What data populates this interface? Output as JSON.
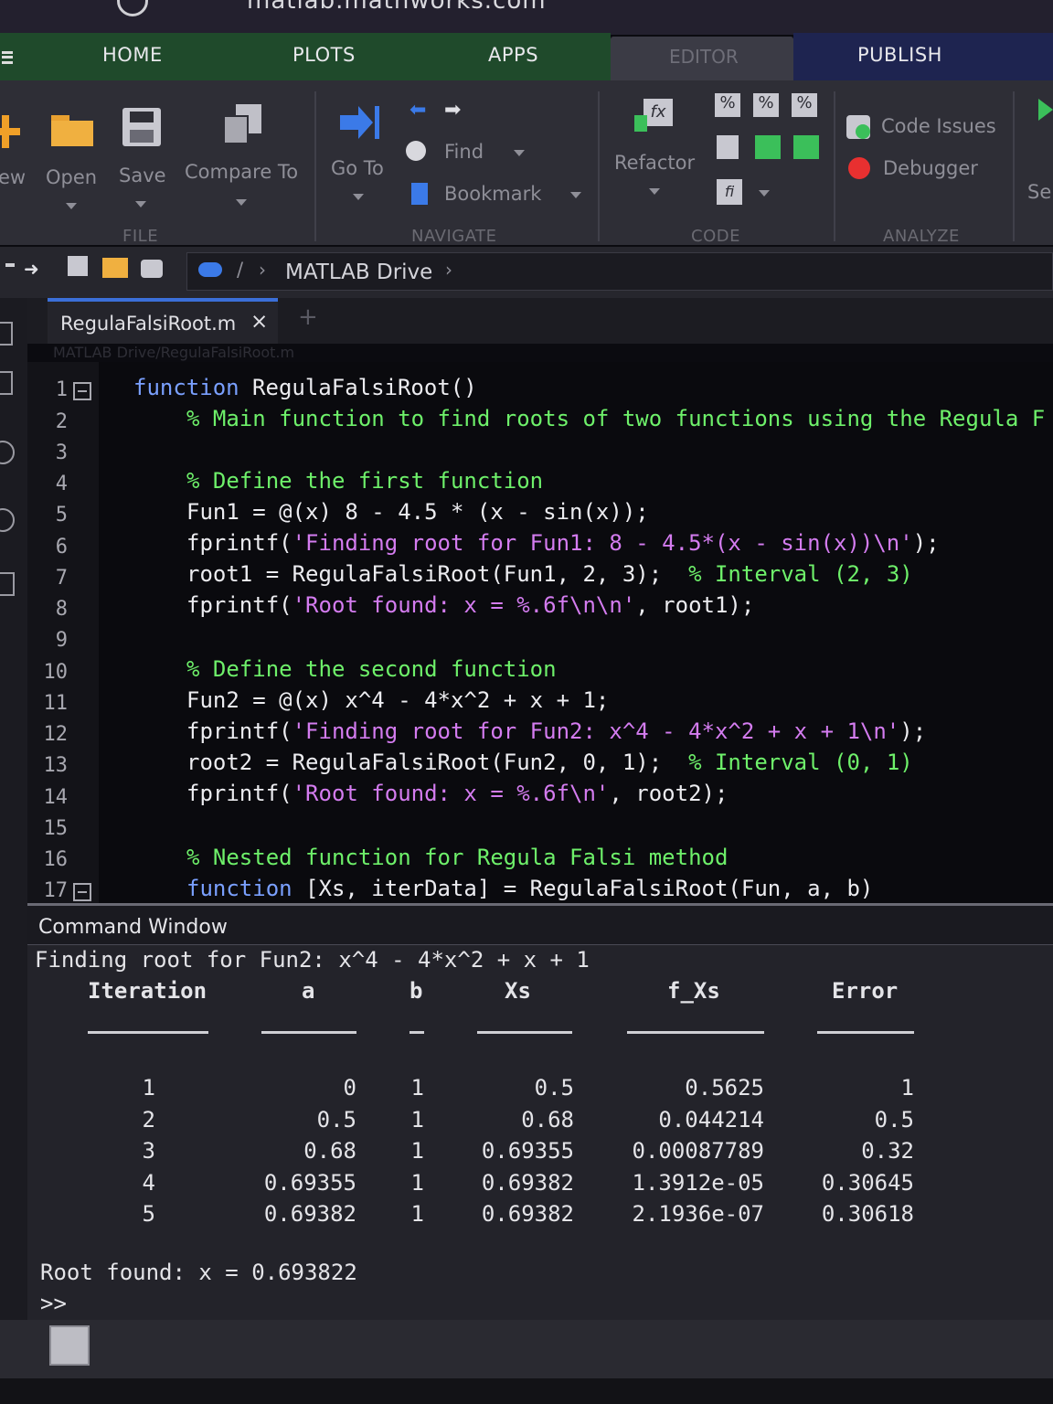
{
  "window": {
    "title": "matlab.mathworks.com"
  },
  "ribbon": {
    "tabs": [
      "HOME",
      "PLOTS",
      "APPS",
      "EDITOR",
      "PUBLISH"
    ],
    "file": {
      "new": "ew",
      "open": "Open",
      "save": "Save",
      "compare": "Compare To",
      "group": "FILE"
    },
    "navigate": {
      "goto": "Go To",
      "find": "Find",
      "bookmark": "Bookmark",
      "group": "NAVIGATE"
    },
    "code": {
      "refactor": "Refactor",
      "group": "CODE"
    },
    "analyze": {
      "code_issues": "Code Issues",
      "debugger": "Debugger",
      "group": "ANALYZE"
    },
    "run": {
      "label": "Se"
    }
  },
  "address": {
    "separator": "/",
    "folder": "MATLAB Drive"
  },
  "editor": {
    "tab_label": "RegulaFalsiRoot.m",
    "close": "×",
    "add": "+",
    "path": "MATLAB Drive/RegulaFalsiRoot.m",
    "line_numbers": [
      "1",
      "2",
      "3",
      "4",
      "5",
      "6",
      "7",
      "8",
      "9",
      "10",
      "11",
      "12",
      "13",
      "14",
      "15",
      "16",
      "17"
    ],
    "lines": {
      "l1_kw": "function",
      "l1_rest": " RegulaFalsiRoot()",
      "l2": "% Main function to find roots of two functions using the Regula F",
      "l4": "% Define the first function",
      "l5": "Fun1 = @(x) 8 - 4.5 * (x - sin(x));",
      "l6_a": "fprintf(",
      "l6_s": "'Finding root for Fun1: 8 - 4.5*(x - sin(x))\\n'",
      "l6_b": ");",
      "l7_a": "root1 = RegulaFalsiRoot(Fun1, 2, 3);  ",
      "l7_c": "% Interval (2, 3)",
      "l8_a": "fprintf(",
      "l8_s": "'Root found: x = %.6f\\n\\n'",
      "l8_b": ", root1);",
      "l10": "% Define the second function",
      "l11": "Fun2 = @(x) x^4 - 4*x^2 + x + 1;",
      "l12_a": "fprintf(",
      "l12_s": "'Finding root for Fun2: x^4 - 4*x^2 + x + 1\\n'",
      "l12_b": ");",
      "l13_a": "root2 = RegulaFalsiRoot(Fun2, 0, 1);  ",
      "l13_c": "% Interval (0, 1)",
      "l14_a": "fprintf(",
      "l14_s": "'Root found: x = %.6f\\n'",
      "l14_b": ", root2);",
      "l16": "% Nested function for Regula Falsi method",
      "l17_kw": "function",
      "l17_rest": " [Xs, iterData] = RegulaFalsiRoot(Fun, a, b)"
    }
  },
  "command_window": {
    "title": "Command Window",
    "intro": "Finding root for Fun2: x^4 - 4*x^2 + x + 1",
    "columns": [
      "Iteration",
      "a",
      "b",
      "Xs",
      "f_Xs",
      "Error"
    ],
    "rows": [
      [
        "1",
        "0",
        "1",
        "0.5",
        "0.5625",
        "1"
      ],
      [
        "2",
        "0.5",
        "1",
        "0.68",
        "0.044214",
        "0.5"
      ],
      [
        "3",
        "0.68",
        "1",
        "0.69355",
        "0.00087789",
        "0.32"
      ],
      [
        "4",
        "0.69355",
        "1",
        "0.69382",
        "1.3912e-05",
        "0.30645"
      ],
      [
        "5",
        "0.69382",
        "1",
        "0.69382",
        "2.1936e-07",
        "0.30618"
      ]
    ],
    "result": "Root found: x = 0.693822",
    "prompt": ">>"
  },
  "colors": {
    "keyword": "#7aa0ff",
    "comment": "#6ef06a",
    "string": "#d47cf0",
    "accent_tab": "#3b6fd8"
  }
}
